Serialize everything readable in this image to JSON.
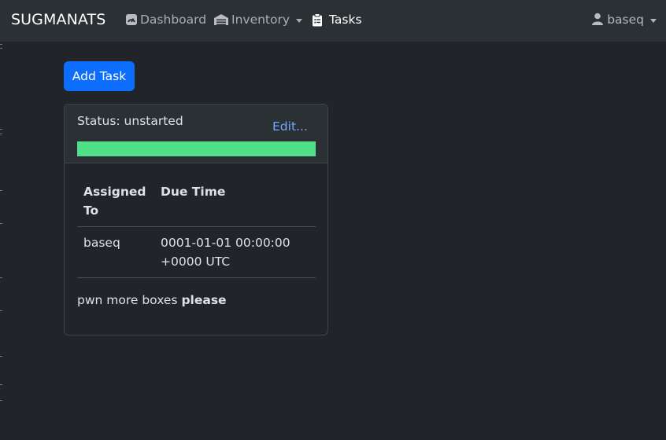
{
  "navbar": {
    "brand": "SUGMANATS",
    "links": [
      {
        "label": "Dashboard",
        "icon": "speedometer-icon"
      },
      {
        "label": "Inventory",
        "icon": "warehouse-icon"
      },
      {
        "label": "Tasks",
        "icon": "clipboard-icon"
      }
    ],
    "user": {
      "label": "baseq",
      "icon": "person-icon"
    }
  },
  "main": {
    "add_task_label": "Add Task",
    "task": {
      "status_text": "Status: unstarted",
      "edit_label": "Edit...",
      "progress_fraction": 1.0,
      "progress_color": "#51e08a",
      "table": {
        "headers": [
          "Assigned To",
          "Due Time"
        ],
        "rows": [
          [
            "baseq",
            "0001-01-01 00:00:00 +0000 UTC"
          ]
        ]
      },
      "description_plain": "pwn more boxes ",
      "description_bold": "please"
    }
  },
  "colors": {
    "accent": "#0d6efd",
    "background": "#212529",
    "navbar": "#2b3035",
    "link": "#6ea8fe"
  }
}
